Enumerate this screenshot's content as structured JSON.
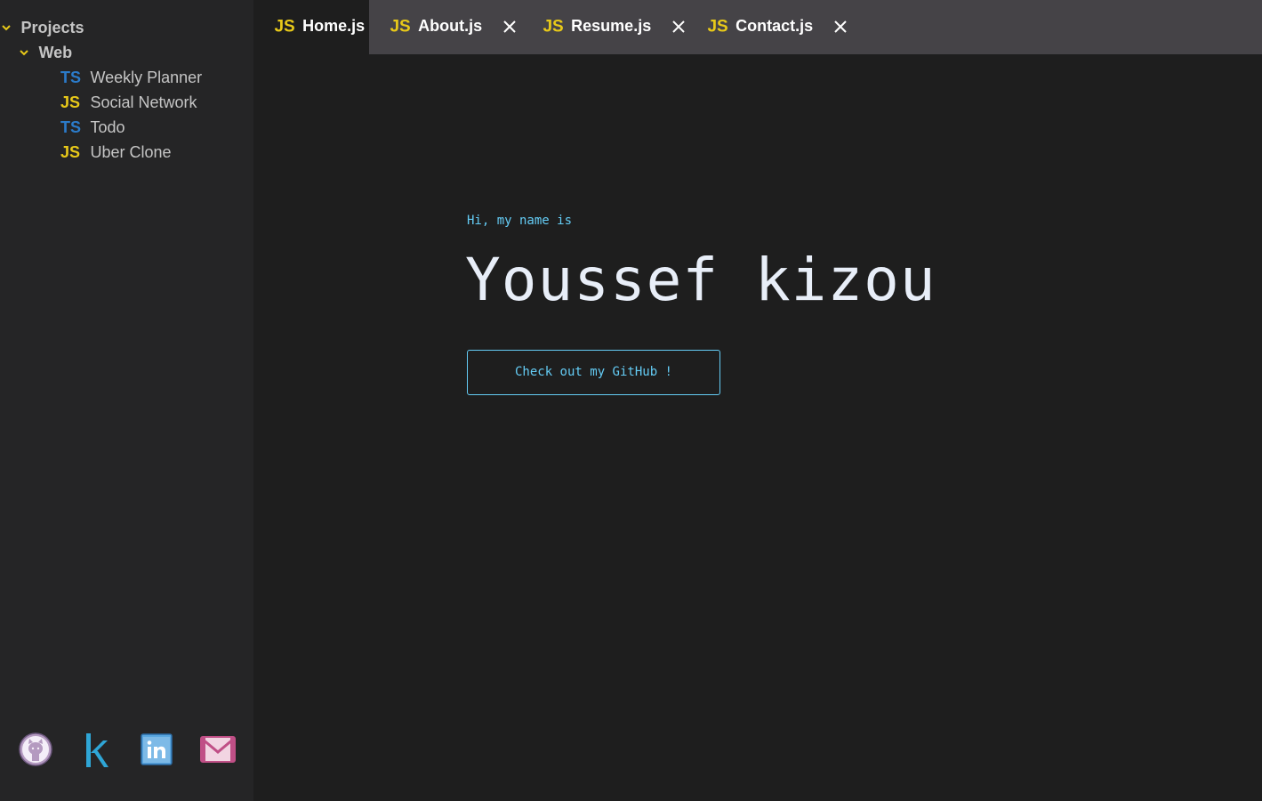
{
  "sidebar": {
    "root": {
      "label": "Projects",
      "expanded": true
    },
    "folder": {
      "label": "Web",
      "expanded": true
    },
    "files": [
      {
        "badge": "TS",
        "label": "Weekly Planner",
        "badge_color": "#2b7bc9"
      },
      {
        "badge": "JS",
        "label": "Social Network",
        "badge_color": "#e8c919"
      },
      {
        "badge": "TS",
        "label": "Todo",
        "badge_color": "#2b7bc9"
      },
      {
        "badge": "JS",
        "label": "Uber Clone",
        "badge_color": "#e8c919"
      }
    ],
    "socials": [
      {
        "icon": "github-icon"
      },
      {
        "icon": "kaggle-icon"
      },
      {
        "icon": "linkedin-icon"
      },
      {
        "icon": "mail-icon"
      }
    ]
  },
  "tabs": [
    {
      "badge": "JS",
      "label": "Home.js",
      "active": true,
      "closable": false
    },
    {
      "badge": "JS",
      "label": "About.js",
      "active": false,
      "closable": true
    },
    {
      "badge": "JS",
      "label": "Resume.js",
      "active": false,
      "closable": true
    },
    {
      "badge": "JS",
      "label": "Contact.js",
      "active": false,
      "closable": true
    }
  ],
  "home": {
    "greeting": "Hi, my name is",
    "name": "Youssef kizou",
    "cta_label": "Check out my GitHub !"
  },
  "colors": {
    "accent": "#64ccf5",
    "js_badge": "#e8c919",
    "ts_badge": "#2b7bc9",
    "sidebar_bg": "#252526",
    "editor_bg": "#1e1e1e",
    "tabbar_bg": "#454347"
  }
}
